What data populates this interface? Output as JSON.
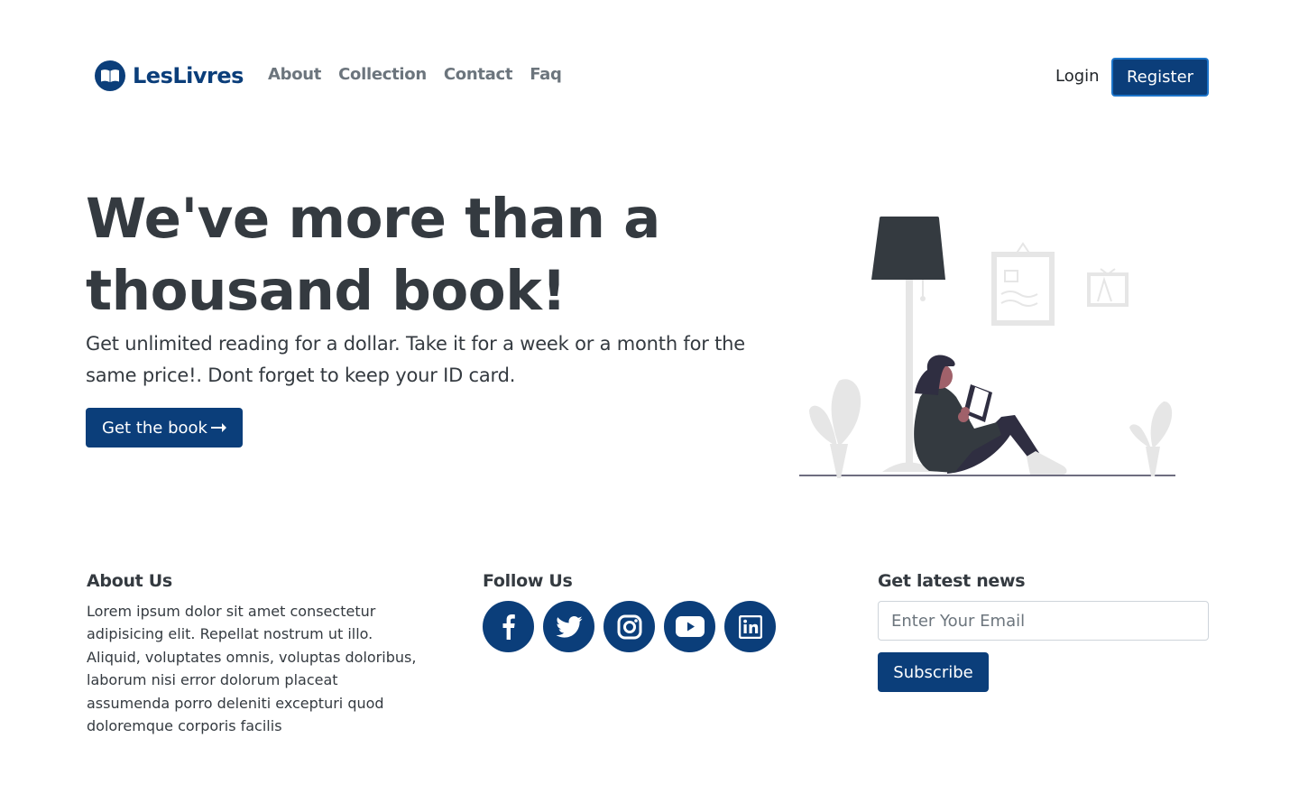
{
  "brand": {
    "name": "LesLivres"
  },
  "nav": {
    "links": [
      "About",
      "Collection",
      "Contact",
      "Faq"
    ],
    "login": "Login",
    "register": "Register"
  },
  "hero": {
    "title": "We've more than a thousand book!",
    "text": "Get unlimited reading for a dollar. Take it for a week or a month for the same price!. Dont forget to keep your ID card.",
    "cta": "Get the book"
  },
  "footer": {
    "about": {
      "heading": "About Us",
      "text": "Lorem ipsum dolor sit amet consectetur adipisicing elit. Repellat nostrum ut illo. Aliquid, voluptates omnis, voluptas doloribus, laborum nisi error dolorum placeat assumenda porro deleniti excepturi quod doloremque corporis facilis"
    },
    "follow": {
      "heading": "Follow Us",
      "icons": [
        "facebook-icon",
        "twitter-icon",
        "instagram-icon",
        "youtube-icon",
        "linkedin-icon"
      ]
    },
    "news": {
      "heading": "Get latest news",
      "placeholder": "Enter Your Email",
      "subscribe": "Subscribe"
    }
  },
  "colors": {
    "primary": "#0b3e7a",
    "text": "#343a40",
    "muted": "#6c757d",
    "accent": "#a0616a"
  }
}
